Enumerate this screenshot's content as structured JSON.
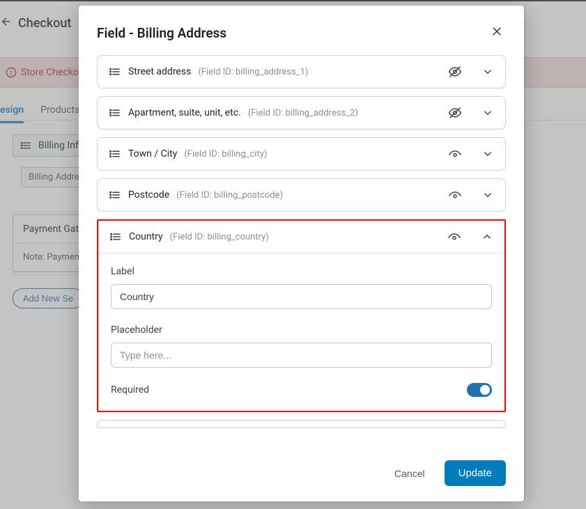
{
  "background": {
    "page_title": "Checkout",
    "alert_text": "Store Checkout",
    "tabs": {
      "design": "esign",
      "products": "Products"
    },
    "billing_chip": "Billing Info",
    "billing_sub": "Billing Address",
    "payment_header": "Payment Gateway",
    "payment_note": "Note: Payment",
    "add_btn": "Add New Se"
  },
  "modal": {
    "title": "Field - Billing Address",
    "cancel": "Cancel",
    "update": "Update"
  },
  "fields": [
    {
      "label": "Street address",
      "id_prefix": "(Field ID: ",
      "id": "billing_address_1",
      "id_suffix": ")",
      "hidden": true,
      "expanded": false
    },
    {
      "label": "Apartment, suite, unit, etc.",
      "id_prefix": "(Field ID: ",
      "id": "billing_address_2",
      "id_suffix": ")",
      "hidden": true,
      "expanded": false
    },
    {
      "label": "Town / City",
      "id_prefix": "(Field ID: ",
      "id": "billing_city",
      "id_suffix": ")",
      "hidden": false,
      "expanded": false
    },
    {
      "label": "Postcode",
      "id_prefix": "(Field ID: ",
      "id": "billing_postcode",
      "id_suffix": ")",
      "hidden": false,
      "expanded": false
    },
    {
      "label": "Country",
      "id_prefix": "(Field ID: ",
      "id": "billing_country",
      "id_suffix": ")",
      "hidden": false,
      "expanded": true
    }
  ],
  "expanded_form": {
    "label_label": "Label",
    "label_value": "Country",
    "placeholder_label": "Placeholder",
    "placeholder_hint": "Type here...",
    "required_label": "Required"
  }
}
